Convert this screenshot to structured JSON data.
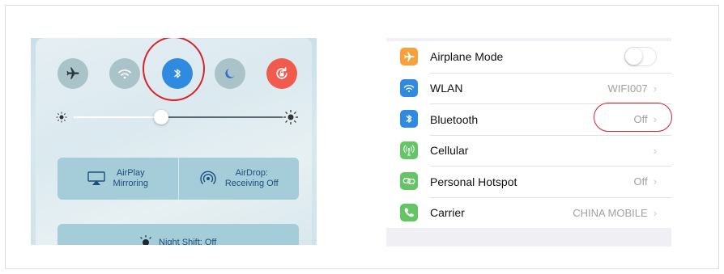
{
  "control_center": {
    "buttons": [
      {
        "icon": "airplane-icon",
        "on": false
      },
      {
        "icon": "wifi-icon",
        "on": false
      },
      {
        "icon": "bluetooth-icon",
        "on": true
      },
      {
        "icon": "moon-icon",
        "on": false
      },
      {
        "icon": "rotation-lock-icon",
        "on": true
      }
    ],
    "brightness": 0.42,
    "airplay_line1": "AirPlay",
    "airplay_line2": "Mirroring",
    "airdrop_line1": "AirDrop:",
    "airdrop_line2": "Receiving Off",
    "night_shift": "Night Shift: Off"
  },
  "settings": {
    "rows": [
      {
        "label": "Airplane Mode",
        "value": "",
        "icon": "airplane-icon",
        "color": "#f7a13a",
        "type": "toggle"
      },
      {
        "label": "WLAN",
        "value": "WIFI007",
        "icon": "wifi-icon",
        "color": "#2f8ae0",
        "type": "link"
      },
      {
        "label": "Bluetooth",
        "value": "Off",
        "icon": "bluetooth-icon",
        "color": "#2f8ae0",
        "type": "link"
      },
      {
        "label": "Cellular",
        "value": "",
        "icon": "cellular-icon",
        "color": "#65c466",
        "type": "link"
      },
      {
        "label": "Personal Hotspot",
        "value": "Off",
        "icon": "hotspot-icon",
        "color": "#65c466",
        "type": "link"
      },
      {
        "label": "Carrier",
        "value": "CHINA MOBILE",
        "icon": "phone-icon",
        "color": "#65c466",
        "type": "link"
      }
    ]
  },
  "colors": {
    "highlight": "#d9222a",
    "accent": "#2f8ae0"
  }
}
